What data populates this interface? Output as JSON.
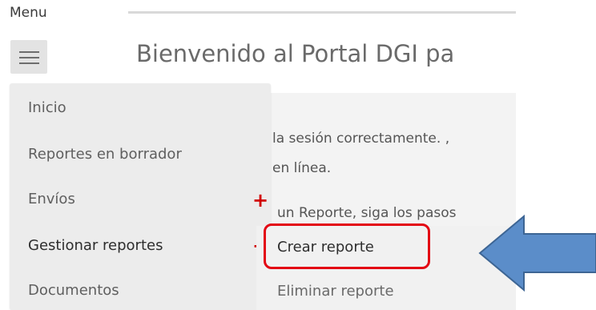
{
  "header": {
    "menu_label": "Menu",
    "page_title": "Bienvenido al Portal DGI pa"
  },
  "content": {
    "line1": "la sesión correctamente. ,",
    "line2": "en línea.",
    "line3": "un Reporte, siga los pasos"
  },
  "side_menu": {
    "items": [
      {
        "label": "Inicio"
      },
      {
        "label": "Reportes en borrador"
      },
      {
        "label": "Envíos",
        "expand_icon": "+"
      },
      {
        "label": "Gestionar reportes",
        "expand_icon": "+"
      },
      {
        "label": "Documentos"
      }
    ]
  },
  "submenu": {
    "items": [
      {
        "label": "Crear reporte"
      },
      {
        "label": "Eliminar reporte"
      }
    ]
  },
  "colors": {
    "highlight": "#e30613",
    "arrow_fill": "#5b8dc9",
    "arrow_stroke": "#3d6594",
    "menu_bg": "#ececec"
  },
  "icons": {
    "menu": "hamburger-icon",
    "expand": "plus-icon",
    "pointer": "left-arrow-icon"
  }
}
